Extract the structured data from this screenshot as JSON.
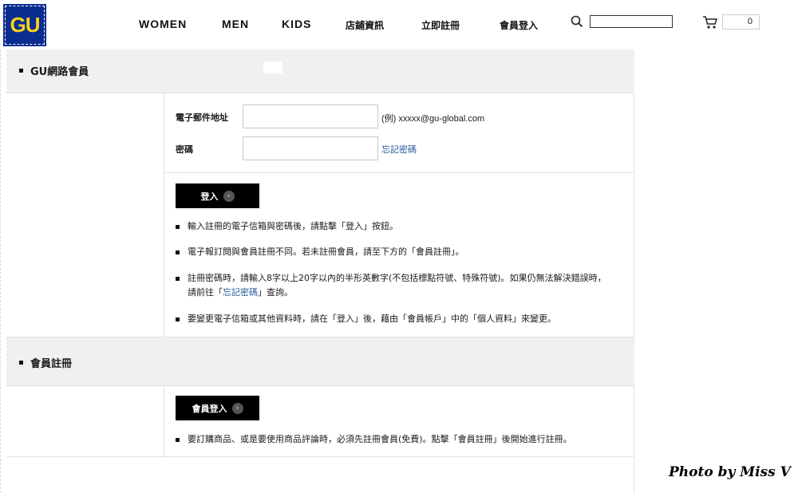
{
  "header": {
    "logo_text": "GU",
    "nav": [
      "WOMEN",
      "MEN",
      "KIDS",
      "店鋪資訊",
      "立即註冊",
      "會員登入"
    ],
    "cart_count": "0",
    "colors": {
      "logo_bg": "#0a2d8f",
      "logo_text": "#f7d417"
    }
  },
  "login_section": {
    "title": "GU網路會員",
    "email_label": "電子郵件地址",
    "email_example": "(例) xxxxx@gu-global.com",
    "password_label": "密碼",
    "forgot_link": "忘記密碼",
    "login_button": "登入",
    "notes": [
      "輸入註冊的電子信箱與密碼後，請點擊「登入」按鈕。",
      "電子報訂閱與會員註冊不同。若未註冊會員，請至下方的「會員註冊」。",
      "註冊密碼時，請輸入8字以上20字以內的半形英數字(不包括標點符號、特殊符號)。如果仍無法解決錯誤時，",
      "要變更電子信箱或其他資料時，請在「登入」後，藉由「會員帳戶」中的「個人資料」來變更。"
    ],
    "note3_line2_prefix": "請前往「",
    "note3_line2_link": "忘記密碼",
    "note3_line2_suffix": "」查詢。"
  },
  "register_section": {
    "title": "會員註冊",
    "button": "會員登入",
    "note": "要訂購商品、或是要使用商品評論時，必須先註冊會員(免費)。點擊「會員註冊」後開始進行註冊。"
  },
  "watermark": "Photo by Miss V",
  "link_color": "#2a5b9c"
}
